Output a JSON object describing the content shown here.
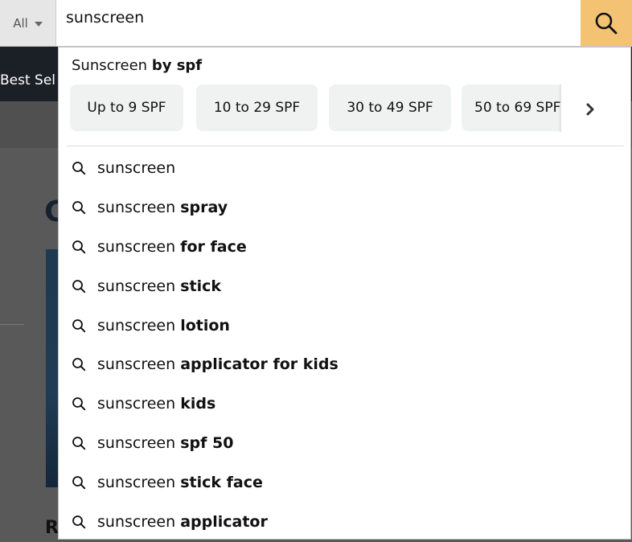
{
  "background": {
    "nav_label": "Best Sell",
    "heading_fragment": "C",
    "bottom_letter": "R"
  },
  "search": {
    "scope_label": "All",
    "query": "sunscreen",
    "button_icon": "magnifier-icon",
    "button_color": "#f3c273"
  },
  "dropdown": {
    "widget": {
      "title_prefix": "Sunscreen",
      "title_bold": "by spf",
      "chips": [
        "Up to 9 SPF",
        "10 to 29 SPF",
        "30 to 49 SPF",
        "50 to 69 SPF"
      ],
      "next_icon": "chevron-right-icon"
    },
    "suggestions": [
      {
        "prefix": "sunscreen",
        "bold": ""
      },
      {
        "prefix": "sunscreen",
        "bold": "spray"
      },
      {
        "prefix": "sunscreen",
        "bold": "for face"
      },
      {
        "prefix": "sunscreen",
        "bold": "stick"
      },
      {
        "prefix": "sunscreen",
        "bold": "lotion"
      },
      {
        "prefix": "sunscreen",
        "bold": "applicator for kids"
      },
      {
        "prefix": "sunscreen",
        "bold": "kids"
      },
      {
        "prefix": "sunscreen",
        "bold": "spf 50"
      },
      {
        "prefix": "sunscreen",
        "bold": "stick face"
      },
      {
        "prefix": "sunscreen",
        "bold": "applicator"
      }
    ]
  }
}
